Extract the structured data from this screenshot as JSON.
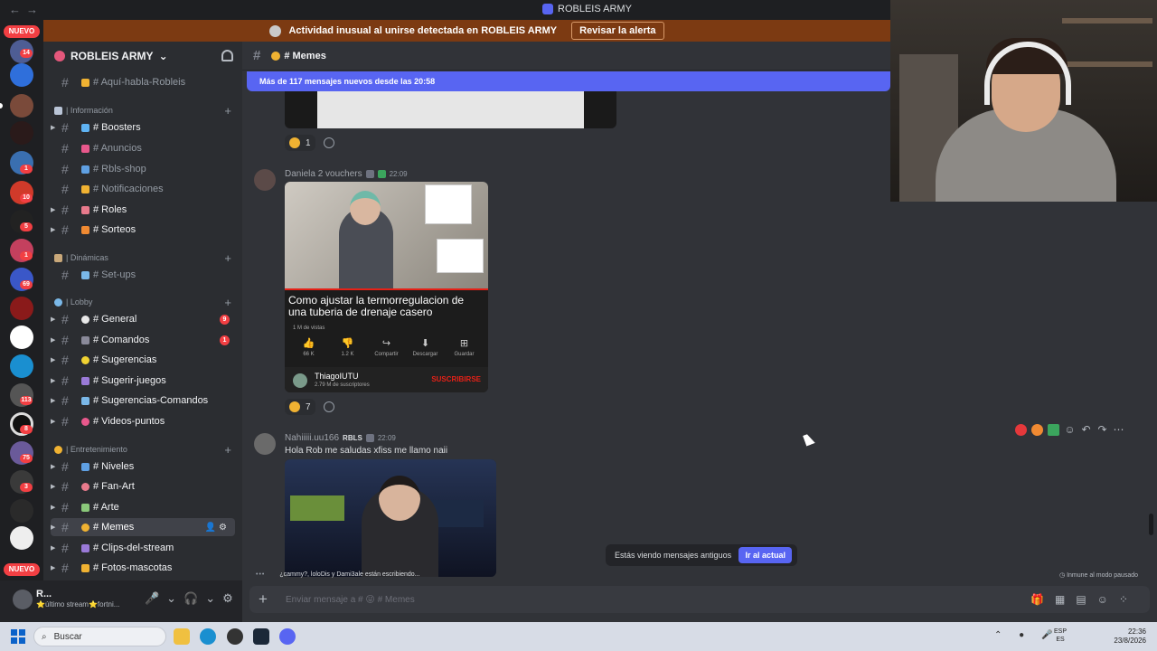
{
  "titlebar": {
    "title": "ROBLEIS ARMY"
  },
  "alert": {
    "text": "Actividad inusual al unirse detectada en ROBLEIS ARMY",
    "button": "Revisar la alerta"
  },
  "guild_rail": {
    "nuevo_top": "NUEVO",
    "nuevo_bottom": "NUEVO",
    "badges": [
      "14",
      "1",
      "10",
      "5",
      "1",
      "69",
      "113",
      "8",
      "75",
      "3"
    ]
  },
  "server": {
    "name": "ROBLEIS ARMY"
  },
  "channels": {
    "top": [
      {
        "name": "# Aquí-habla-Robleis"
      }
    ],
    "cat_informacion": "| Información",
    "informacion": [
      {
        "name": "# Boosters"
      },
      {
        "name": "# Anuncios"
      },
      {
        "name": "# Rbls-shop"
      },
      {
        "name": "# Notificaciones"
      },
      {
        "name": "# Roles"
      },
      {
        "name": "# Sorteos"
      }
    ],
    "cat_dinamicas": "| Dinámicas",
    "dinamicas": [
      {
        "name": "# Set-ups"
      }
    ],
    "cat_lobby": "| Lobby",
    "lobby": [
      {
        "name": "# General",
        "badge": "9"
      },
      {
        "name": "# Comandos",
        "badge": "1"
      },
      {
        "name": "# Sugerencias"
      },
      {
        "name": "# Sugerir-juegos"
      },
      {
        "name": "# Sugerencias-Comandos"
      },
      {
        "name": "# Videos-puntos"
      }
    ],
    "cat_entretenimiento": "| Entretenimiento",
    "entretenimiento": [
      {
        "name": "# Niveles"
      },
      {
        "name": "# Fan-Art"
      },
      {
        "name": "# Arte"
      },
      {
        "name": "# Memes"
      },
      {
        "name": "# Clips-del-stream"
      },
      {
        "name": "# Fotos-mascotas"
      }
    ]
  },
  "user": {
    "name": "R...",
    "status": "⭐último stream⭐fortni..."
  },
  "chat": {
    "channel": "# Memes",
    "new_messages": "Más de 117 mensajes nuevos desde las 20:58",
    "reaction1": "1",
    "msg2": {
      "author": "Daniela 2 vouchers",
      "time": "22:09",
      "reaction": "7",
      "yt": {
        "title": "Como ajustar la termorregulacion de una tuberia de drenaje casero",
        "views": "1 M de vistas",
        "actions": [
          {
            "icon": "👍",
            "label": "66 K"
          },
          {
            "icon": "👎",
            "label": "1.2 K"
          },
          {
            "icon": "↪",
            "label": "Compartir"
          },
          {
            "icon": "⬇",
            "label": "Descargar"
          },
          {
            "icon": "⊞",
            "label": "Guardar"
          }
        ],
        "channel": "ThiagoIUTU",
        "subs": "2.79 M de suscriptores",
        "subscribe": "SUSCRIBIRSE"
      }
    },
    "msg3": {
      "author": "Nahiiiii.uu166",
      "tag": "RBLS",
      "time": "22:09",
      "text": "Hola Rob me saludas xfiss me llamo naii"
    },
    "typing": "¿cammy?, loloDis y Dami3ale están escribiendo...",
    "immune": "Inmune al modo pausado",
    "old_messages": "Estás viendo mensajes antiguos",
    "jump": "Ir al actual",
    "composer_placeholder": "Enviar mensaje a # 😜 # Memes"
  },
  "taskbar": {
    "search": "Buscar",
    "lang1": "ESP",
    "lang2": "ES",
    "time": "22:36",
    "date": "23/8/2026"
  },
  "colors": {
    "accent": "#5865f2",
    "alert_bg": "#7c3a12",
    "badge": "#f23f43"
  }
}
